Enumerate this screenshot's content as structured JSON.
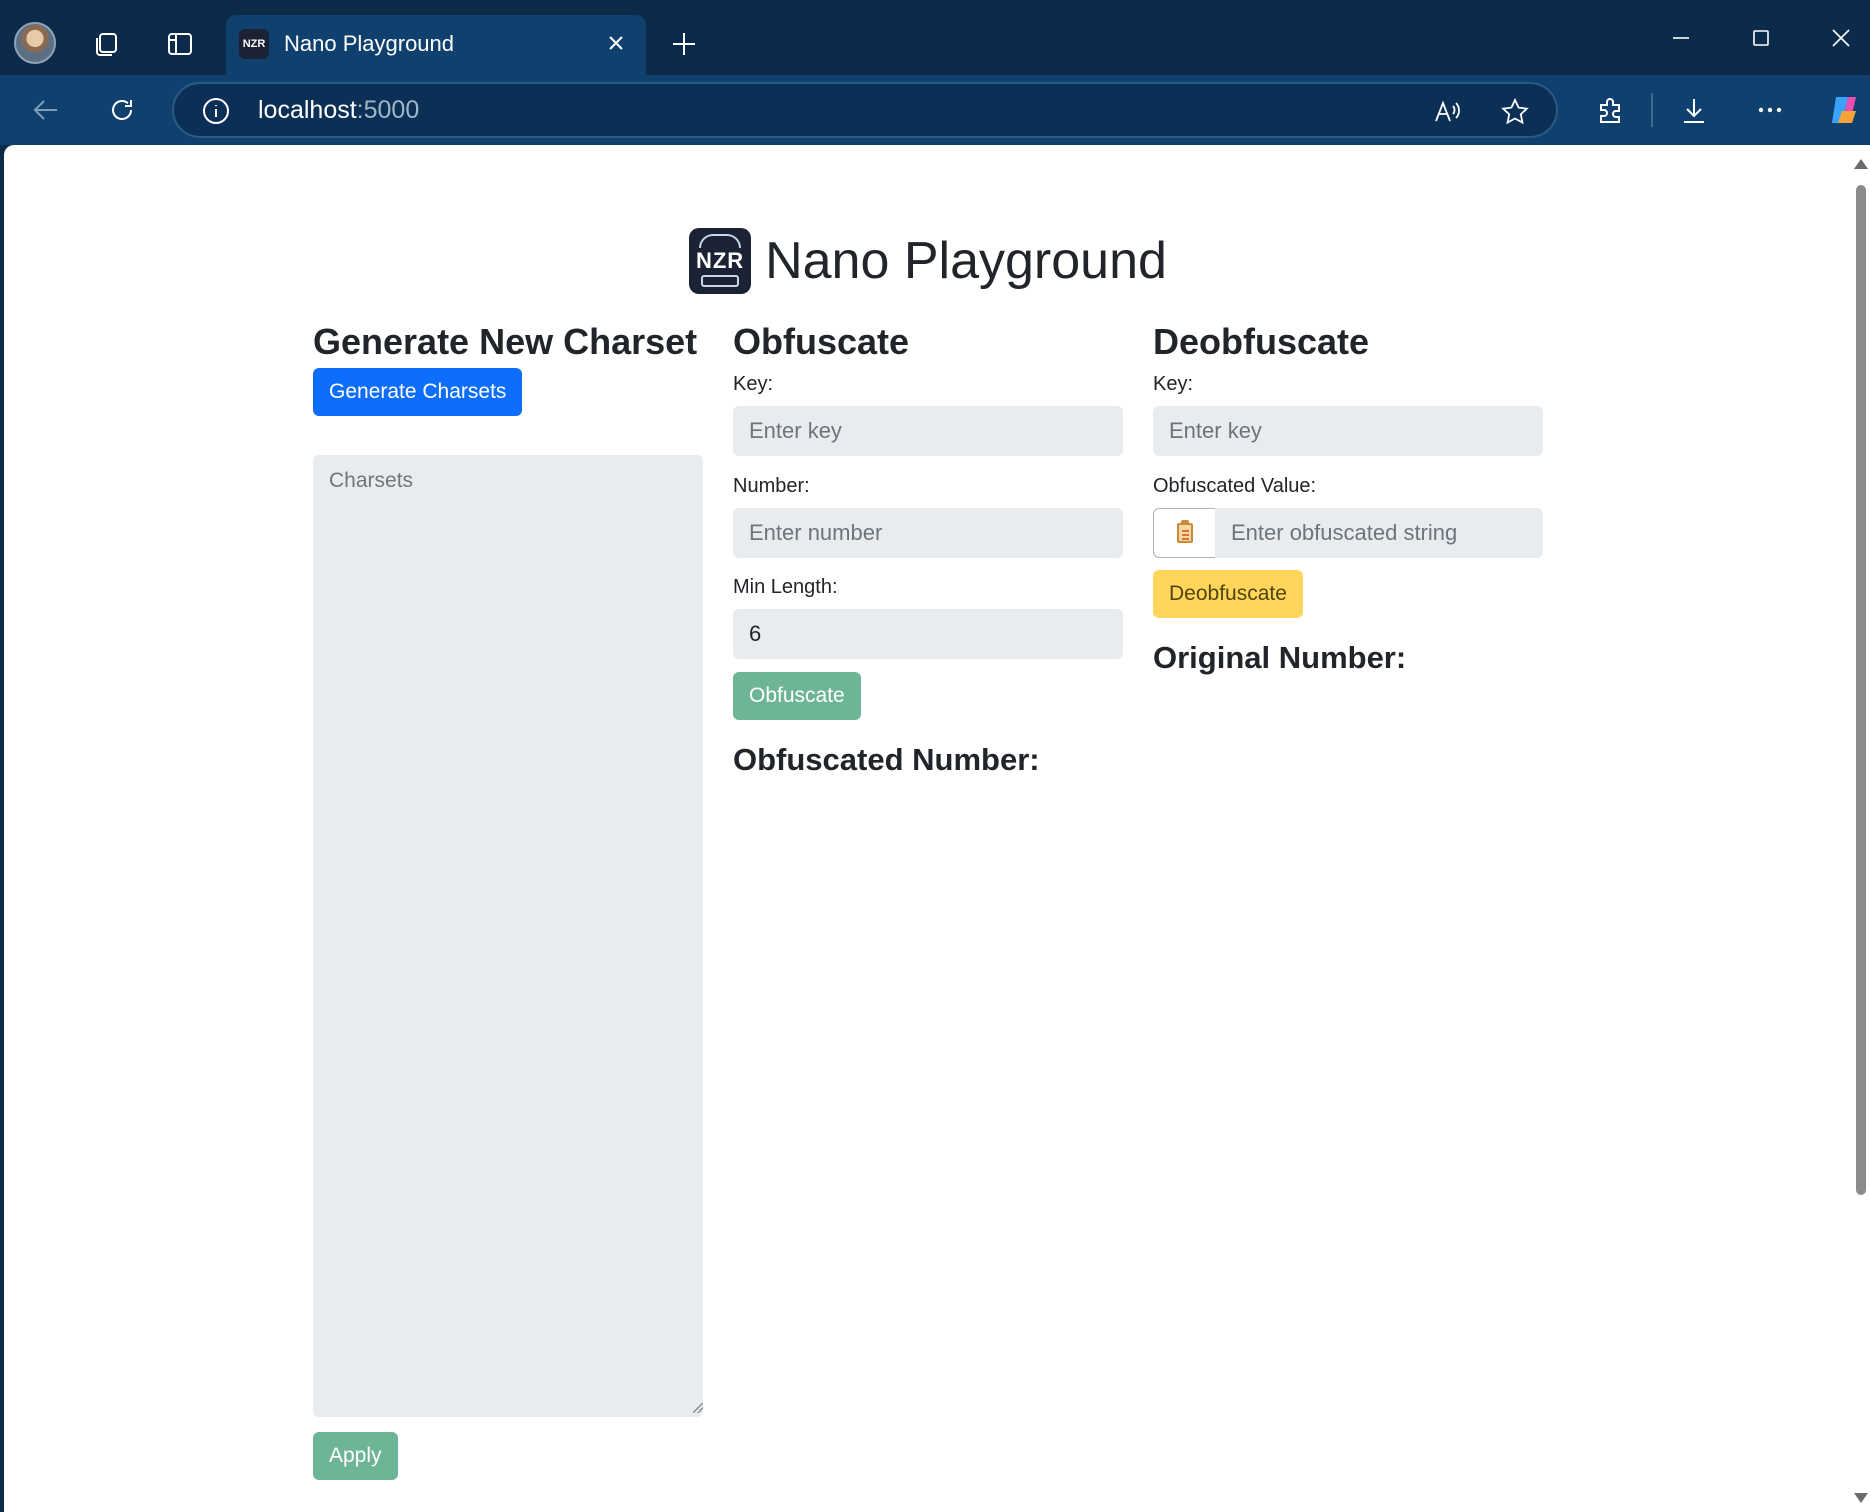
{
  "browser": {
    "tab_title": "Nano Playground",
    "tab_favicon_text": "NZR",
    "url_host": "localhost",
    "url_port": ":5000"
  },
  "page": {
    "title": "Nano Playground",
    "logo_text": "NZR"
  },
  "charset": {
    "heading": "Generate New Charset",
    "generate_button": "Generate Charsets",
    "textarea_placeholder": "Charsets",
    "apply_button": "Apply"
  },
  "obfuscate": {
    "heading": "Obfuscate",
    "key_label": "Key:",
    "key_placeholder": "Enter key",
    "number_label": "Number:",
    "number_placeholder": "Enter number",
    "min_length_label": "Min Length:",
    "min_length_value": "6",
    "button": "Obfuscate",
    "result_title": "Obfuscated Number:"
  },
  "deobfuscate": {
    "heading": "Deobfuscate",
    "key_label": "Key:",
    "key_placeholder": "Enter key",
    "value_label": "Obfuscated Value:",
    "value_placeholder": "Enter obfuscated string",
    "button": "Deobfuscate",
    "result_title": "Original Number:"
  },
  "colors": {
    "primary": "#0d6efd",
    "success": "#6db595",
    "warning": "#ffd55a",
    "input_bg": "#e9ecef",
    "chrome_bg": "#10416e"
  }
}
